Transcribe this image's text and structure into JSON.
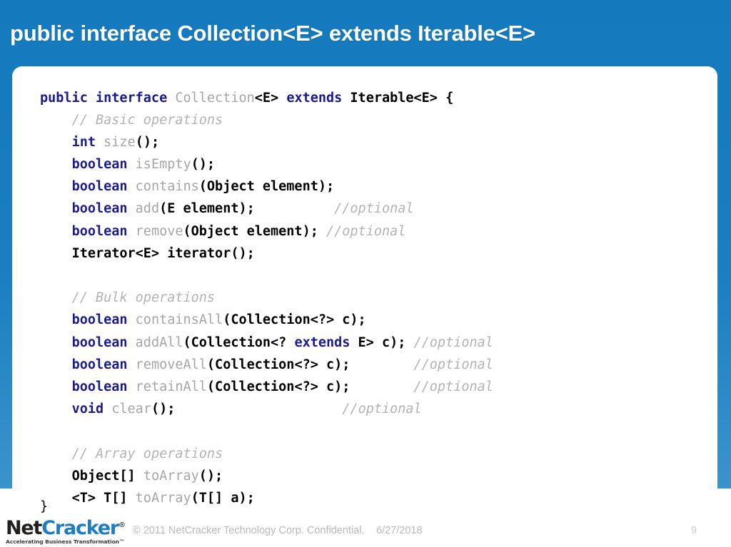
{
  "slide": {
    "title": "public interface Collection<E> extends Iterable<E>",
    "accent_color": "#1479bd",
    "accent_color_bottom": "#3b93cd",
    "card_background": "#ffffff"
  },
  "code": {
    "language": "java",
    "colors": {
      "keyword": "#1b1b8f",
      "identifier": "#a6a6a6",
      "comment": "#b3b3b3",
      "type": "#000000"
    },
    "lines": [
      {
        "id": "line-declaration",
        "tokens": [
          {
            "t": "public",
            "c": "kw"
          },
          {
            "t": " ",
            "c": "plain"
          },
          {
            "t": "interface",
            "c": "kw"
          },
          {
            "t": " ",
            "c": "plain"
          },
          {
            "t": "Collection",
            "c": "ident"
          },
          {
            "t": "<E>",
            "c": "type"
          },
          {
            "t": " ",
            "c": "plain"
          },
          {
            "t": "extends",
            "c": "kw"
          },
          {
            "t": " ",
            "c": "plain"
          },
          {
            "t": "Iterable<E> {",
            "c": "type"
          }
        ]
      },
      {
        "id": "line-comment-basic",
        "tokens": [
          {
            "t": "    ",
            "c": "plain"
          },
          {
            "t": "// Basic operations",
            "c": "comment"
          }
        ]
      },
      {
        "id": "line-size",
        "tokens": [
          {
            "t": "    ",
            "c": "plain"
          },
          {
            "t": "int",
            "c": "kw"
          },
          {
            "t": " ",
            "c": "plain"
          },
          {
            "t": "size",
            "c": "ident"
          },
          {
            "t": "();",
            "c": "type"
          }
        ]
      },
      {
        "id": "line-isempty",
        "tokens": [
          {
            "t": "    ",
            "c": "plain"
          },
          {
            "t": "boolean",
            "c": "kw"
          },
          {
            "t": " ",
            "c": "plain"
          },
          {
            "t": "isEmpty",
            "c": "ident"
          },
          {
            "t": "();",
            "c": "type"
          }
        ]
      },
      {
        "id": "line-contains",
        "tokens": [
          {
            "t": "    ",
            "c": "plain"
          },
          {
            "t": "boolean",
            "c": "kw"
          },
          {
            "t": " ",
            "c": "plain"
          },
          {
            "t": "contains",
            "c": "ident"
          },
          {
            "t": "(Object element);",
            "c": "type"
          }
        ]
      },
      {
        "id": "line-add",
        "tokens": [
          {
            "t": "    ",
            "c": "plain"
          },
          {
            "t": "boolean",
            "c": "kw"
          },
          {
            "t": " ",
            "c": "plain"
          },
          {
            "t": "add",
            "c": "ident"
          },
          {
            "t": "(E element);",
            "c": "type"
          },
          {
            "t": "          ",
            "c": "plain"
          },
          {
            "t": "//optional",
            "c": "comment"
          }
        ]
      },
      {
        "id": "line-remove",
        "tokens": [
          {
            "t": "    ",
            "c": "plain"
          },
          {
            "t": "boolean",
            "c": "kw"
          },
          {
            "t": " ",
            "c": "plain"
          },
          {
            "t": "remove",
            "c": "ident"
          },
          {
            "t": "(Object element);",
            "c": "type"
          },
          {
            "t": " ",
            "c": "plain"
          },
          {
            "t": "//optional",
            "c": "comment"
          }
        ]
      },
      {
        "id": "line-iterator",
        "tokens": [
          {
            "t": "    ",
            "c": "plain"
          },
          {
            "t": "Iterator<E> iterator();",
            "c": "type"
          }
        ]
      },
      {
        "id": "line-blank-1",
        "tokens": []
      },
      {
        "id": "line-comment-bulk",
        "tokens": [
          {
            "t": "    ",
            "c": "plain"
          },
          {
            "t": "// Bulk operations",
            "c": "comment"
          }
        ]
      },
      {
        "id": "line-containsall",
        "tokens": [
          {
            "t": "    ",
            "c": "plain"
          },
          {
            "t": "boolean",
            "c": "kw"
          },
          {
            "t": " ",
            "c": "plain"
          },
          {
            "t": "containsAll",
            "c": "ident"
          },
          {
            "t": "(Collection<?> c);",
            "c": "type"
          }
        ]
      },
      {
        "id": "line-addall",
        "tokens": [
          {
            "t": "    ",
            "c": "plain"
          },
          {
            "t": "boolean",
            "c": "kw"
          },
          {
            "t": " ",
            "c": "plain"
          },
          {
            "t": "addAll",
            "c": "ident"
          },
          {
            "t": "(Collection<? ",
            "c": "type"
          },
          {
            "t": "extends",
            "c": "kw"
          },
          {
            "t": " E> c);",
            "c": "type"
          },
          {
            "t": " ",
            "c": "plain"
          },
          {
            "t": "//optional",
            "c": "comment"
          }
        ]
      },
      {
        "id": "line-removeall",
        "tokens": [
          {
            "t": "    ",
            "c": "plain"
          },
          {
            "t": "boolean",
            "c": "kw"
          },
          {
            "t": " ",
            "c": "plain"
          },
          {
            "t": "removeAll",
            "c": "ident"
          },
          {
            "t": "(Collection<?> c);",
            "c": "type"
          },
          {
            "t": "        ",
            "c": "plain"
          },
          {
            "t": "//optional",
            "c": "comment"
          }
        ]
      },
      {
        "id": "line-retainall",
        "tokens": [
          {
            "t": "    ",
            "c": "plain"
          },
          {
            "t": "boolean",
            "c": "kw"
          },
          {
            "t": " ",
            "c": "plain"
          },
          {
            "t": "retainAll",
            "c": "ident"
          },
          {
            "t": "(Collection<?> c);",
            "c": "type"
          },
          {
            "t": "        ",
            "c": "plain"
          },
          {
            "t": "//optional",
            "c": "comment"
          }
        ]
      },
      {
        "id": "line-clear",
        "tokens": [
          {
            "t": "    ",
            "c": "plain"
          },
          {
            "t": "void",
            "c": "kw"
          },
          {
            "t": " ",
            "c": "plain"
          },
          {
            "t": "clear",
            "c": "ident"
          },
          {
            "t": "();",
            "c": "type"
          },
          {
            "t": "                     ",
            "c": "plain"
          },
          {
            "t": "//optional",
            "c": "comment"
          }
        ]
      },
      {
        "id": "line-blank-2",
        "tokens": []
      },
      {
        "id": "line-comment-array",
        "tokens": [
          {
            "t": "    ",
            "c": "plain"
          },
          {
            "t": "// Array operations",
            "c": "comment"
          }
        ]
      },
      {
        "id": "line-toarray",
        "tokens": [
          {
            "t": "    ",
            "c": "plain"
          },
          {
            "t": "Object[] ",
            "c": "type"
          },
          {
            "t": "toArray",
            "c": "ident"
          },
          {
            "t": "();",
            "c": "type"
          }
        ]
      },
      {
        "id": "line-toarray-generic",
        "tokens": [
          {
            "t": "    ",
            "c": "plain"
          },
          {
            "t": "<T> T[] ",
            "c": "type"
          },
          {
            "t": "toArray",
            "c": "ident"
          },
          {
            "t": "(T[] a);",
            "c": "type"
          }
        ]
      }
    ],
    "closing_brace": "}"
  },
  "footer": {
    "logo": {
      "part_one": "Net",
      "part_two": "Cracker",
      "registered_mark": "®",
      "tagline": "Accelerating Business Transformation™",
      "part_one_color": "#221f1f",
      "part_two_color": "#1f7dc4"
    },
    "copyright": "© 2011 NetCracker Technology Corp. Confidential.",
    "date": "6/27/2018",
    "page_number": "9"
  }
}
